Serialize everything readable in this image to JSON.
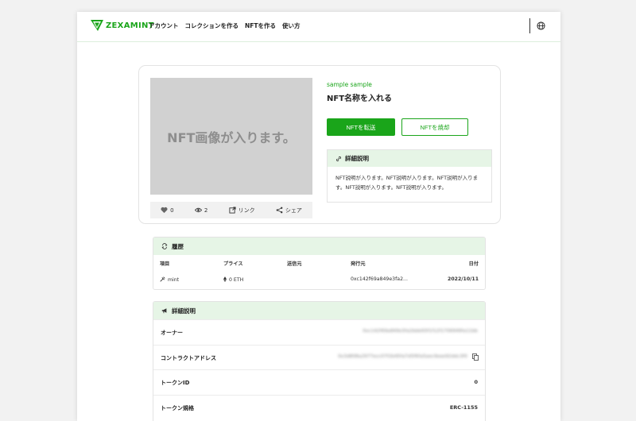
{
  "header": {
    "logo_text": "ZEXAMINT",
    "nav": [
      "アカウント",
      "コレクションを作る",
      "NFTを作る",
      "使い方"
    ],
    "icon": "globe-icon"
  },
  "nft": {
    "image_placeholder": "NFT画像が入ります。",
    "collection": "sample sample",
    "name": "NFT名称を入れる",
    "transfer_label": "NFTを転送",
    "burn_label": "NFTを焼却",
    "stats": {
      "likes": "0",
      "views": "2",
      "link_label": "リンク",
      "share_label": "シェア"
    },
    "description": {
      "title": "詳細説明",
      "text": "NFT説明が入ります。NFT説明が入ります。NFT説明が入ります。NFT説明が入ります。NFT説明が入ります。"
    }
  },
  "history": {
    "title": "履歴",
    "columns": [
      "項目",
      "プライス",
      "送信元",
      "発行元",
      "日付"
    ],
    "rows": [
      {
        "item": "mint",
        "price": "0 ETH",
        "from": "",
        "issuer": "0xc142f69a849e3fa2...",
        "date": "2022/10/11"
      }
    ]
  },
  "details": {
    "title": "詳細説明",
    "rows": [
      {
        "label": "オーナー",
        "value": "0xc142f69a849e3fa2bbb93f1f12f1706949fa11bb"
      },
      {
        "label": "コントラクトアドレス",
        "value": "0x3d808a2977ecc07f2b45fa7d5f6fa5aec9eae92ddc3f0"
      },
      {
        "label": "トークンID",
        "value": "0"
      },
      {
        "label": "トークン規格",
        "value": "ERC-1155"
      }
    ]
  },
  "colors": {
    "accent": "#1aa51a",
    "section_bg": "#e6f5e6",
    "image_bg": "#d1d1d1"
  }
}
